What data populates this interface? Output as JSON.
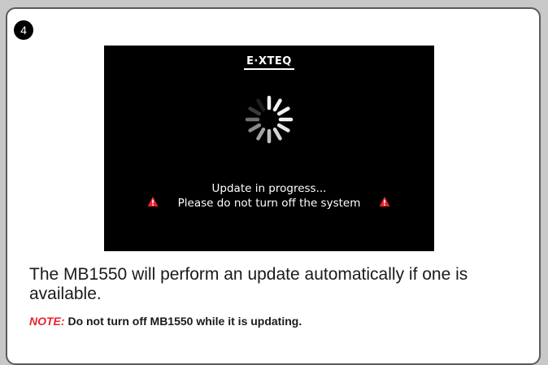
{
  "step": {
    "number": "4"
  },
  "device_screen": {
    "logo_text": "E·XTEQ",
    "status_line1": "Update in progress...",
    "status_line2": "Please do not turn off the system",
    "warning_icon": "warning-triangle-icon",
    "warning_color": "#e8232a"
  },
  "instructions": {
    "description": "The MB1550 will perform an update automatically if one is available.",
    "note_label": "NOTE:",
    "note_text": "Do not turn off MB1550 while it is updating."
  },
  "colors": {
    "page_background": "#c8c8c8",
    "card_border": "#5a5a5a",
    "screen_background": "#000000",
    "note_label": "#e8232a"
  }
}
